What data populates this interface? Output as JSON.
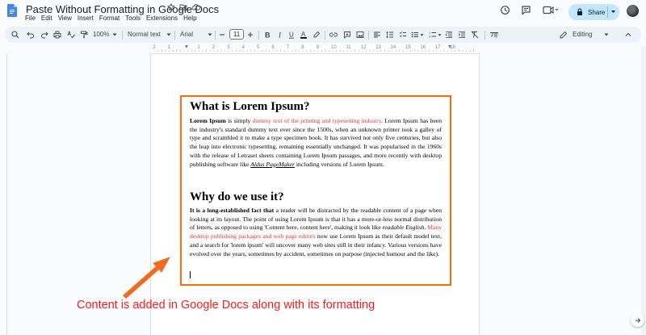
{
  "document": {
    "title": "Paste Without Formatting in Google Docs"
  },
  "menu": [
    "File",
    "Edit",
    "View",
    "Insert",
    "Format",
    "Tools",
    "Extensions",
    "Help"
  ],
  "share": {
    "label": "Share"
  },
  "toolbar": {
    "zoom": "100%",
    "style": "Normal text",
    "font": "Arial",
    "font_size": "11",
    "mode": "Editing"
  },
  "ruler": {
    "labels": [
      "2",
      "1",
      "1",
      "2",
      "3",
      "4",
      "5",
      "6",
      "7",
      "8",
      "9",
      "10",
      "11",
      "12",
      "13",
      "14",
      "15",
      "16",
      "17",
      "18"
    ]
  },
  "content": {
    "heading1": "What is Lorem Ipsum?",
    "p1_bold": "Lorem Ipsum",
    "p1_t1": " is simply ",
    "p1_red": "dummy text of the printing and typesetting industry",
    "p1_t2": ". Lorem Ipsum has been the industry's standard dummy text ever since the 1500s, when an unknown printer took a galley of type and scrambled it to make a type specimen book. It has survived not only five centuries, but also the leap into electronic typesetting, remaining essentially unchanged. It was popularised in the 1960s with the release of Letraset sheets containing Lorem Ipsum passages, and more recently with desktop publishing software like ",
    "p1_link": "Aldus PageMaker",
    "p1_t3": " including versions of Lorem Ipsum.",
    "heading2": "Why do we use it?",
    "p2_bold": "It is a long-established fact that",
    "p2_t1": " a reader will be distracted by the readable content of a page when looking at its layout. The point of using Lorem Ipsum is that it has a more-or-less normal distribution of letters, as opposed to using 'Content here, content here', making it look like ",
    "p2_italic": "readable English",
    "p2_t2": ". ",
    "p2_red": "Many desktop publishing packages and web page editors",
    "p2_t3": " now use Lorem Ipsum as their default model text, and a search for 'lorem ipsum' will uncover many web sites still in their infancy. Various versions have evolved over the years, sometimes by accident, sometimes on purpose (injected humour and the like)."
  },
  "annotation": {
    "text": "Content is added in Google Docs along with its formatting",
    "color": "#ff1a1a",
    "arrow_color": "#f26b1d"
  },
  "colors": {
    "share_bg": "#c2e7ff",
    "toolbar_bg": "#edf2fa",
    "highlight_box": "#ff6d01",
    "red_text": "#e53935"
  }
}
